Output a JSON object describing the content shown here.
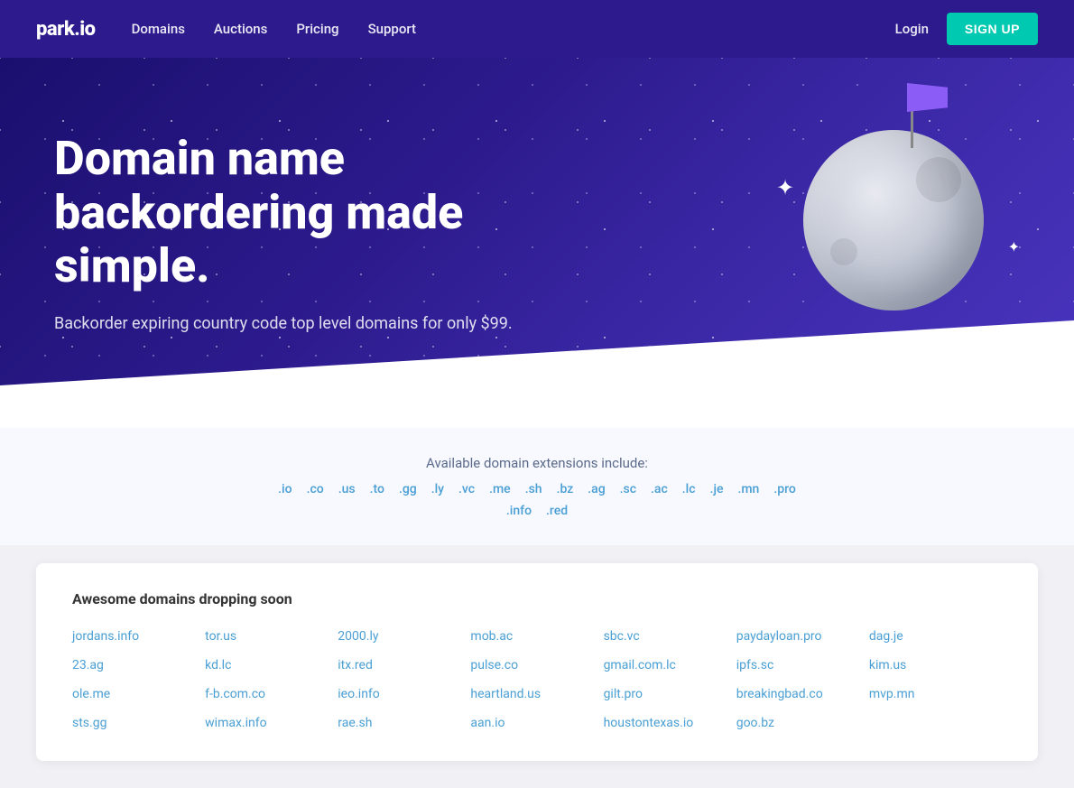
{
  "nav": {
    "logo": "park.io",
    "links": [
      "Domains",
      "Auctions",
      "Pricing",
      "Support"
    ],
    "login_label": "Login",
    "signup_label": "SIGN UP"
  },
  "hero": {
    "title": "Domain name backordering made simple.",
    "subtitle": "Backorder expiring country code top level domains for only $99."
  },
  "extensions": {
    "heading": "Available domain extensions include:",
    "row1": [
      ".io",
      ".co",
      ".us",
      ".to",
      ".gg",
      ".ly",
      ".vc",
      ".me",
      ".sh",
      ".bz",
      ".ag",
      ".sc",
      ".ac",
      ".lc",
      ".je",
      ".mn",
      ".pro"
    ],
    "row2": [
      ".info",
      ".red"
    ]
  },
  "domains": {
    "heading": "Awesome domains dropping soon",
    "columns": [
      [
        "jordans.info",
        "23.ag",
        "ole.me",
        "sts.gg"
      ],
      [
        "tor.us",
        "kd.lc",
        "f-b.com.co",
        "wimax.info"
      ],
      [
        "2000.ly",
        "itx.red",
        "ieo.info",
        "rae.sh"
      ],
      [
        "mob.ac",
        "pulse.co",
        "heartland.us",
        "aan.io"
      ],
      [
        "sbc.vc",
        "gmail.com.lc",
        "gilt.pro",
        "houstontexas.io"
      ],
      [
        "paydayloan.pro",
        "ipfs.sc",
        "breakingbad.co",
        "goo.bz"
      ],
      [
        "dag.je",
        "kim.us",
        "mvp.mn",
        ""
      ]
    ]
  }
}
